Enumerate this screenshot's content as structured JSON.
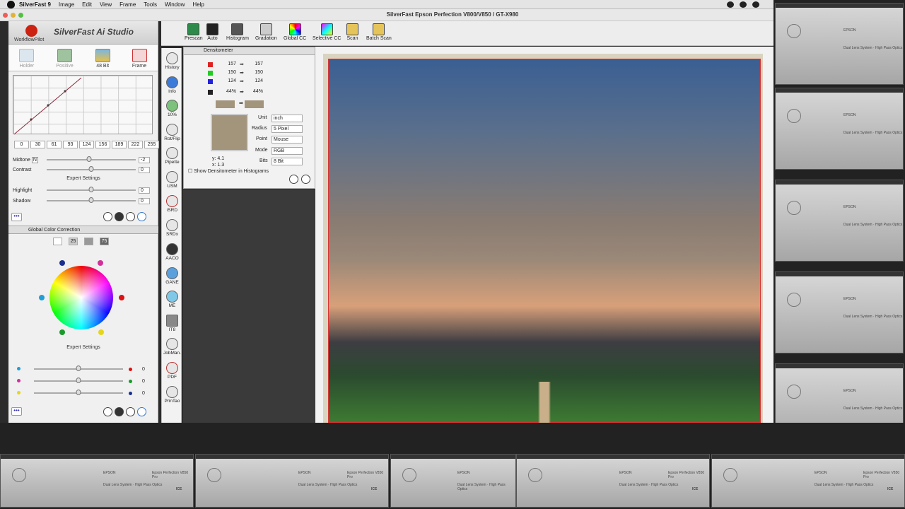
{
  "menubar": {
    "app": "SilverFast 9",
    "items": [
      "Image",
      "Edit",
      "View",
      "Frame",
      "Tools",
      "Window",
      "Help"
    ]
  },
  "window": {
    "title": "SilverFast  Epson Perfection V800/V850 / GT-X980"
  },
  "left_panel": {
    "workflow_pilot": "WorkflowPilot",
    "brand": "SilverFast Ai Studio",
    "modes": [
      "Holder",
      "Positive",
      "48 Bit",
      "Frame"
    ],
    "curve_values": [
      "0",
      "30",
      "61",
      "93",
      "124",
      "156",
      "189",
      "222",
      "255"
    ],
    "midtone": {
      "label": "Midtone",
      "flag": "N",
      "value": "-2",
      "level": 0.48
    },
    "contrast": {
      "label": "Contrast",
      "value": "0",
      "level": 0.5
    },
    "expert_settings": "Expert Settings",
    "highlight": {
      "label": "Highlight",
      "value": "0",
      "level": 0.5
    },
    "shadow": {
      "label": "Shadow",
      "value": "0",
      "level": 0.5
    },
    "more": "•••",
    "gcc": {
      "title": "Global Color Correction",
      "view_buttons": [
        "",
        "25",
        "",
        "75"
      ],
      "expert_settings": "Expert Settings",
      "sliders": [
        {
          "value": "0",
          "left_color": "#1e9fd6",
          "right_color": "#d11",
          "level": 0.5
        },
        {
          "value": "0",
          "left_color": "#d22f9a",
          "right_color": "#1a9a2a",
          "level": 0.5
        },
        {
          "value": "0",
          "left_color": "#e6d61a",
          "right_color": "#1b2f8f",
          "level": 0.5
        }
      ]
    }
  },
  "tool_strip": [
    "History",
    "Info",
    "10%",
    "Rot/Flip",
    "Pipette",
    "USM",
    "iSRD",
    "SRDx",
    "AACO",
    "GANE",
    "ME",
    "IT8",
    "JobMan.",
    "PDF",
    "PrinTao"
  ],
  "top_toolbar": [
    "Prescan",
    "Auto",
    "Histogram",
    "Gradation",
    "Global CC",
    "Selective CC",
    "Scan",
    "Batch Scan"
  ],
  "densitometer": {
    "title": "Densitometer",
    "rows": [
      {
        "ch": "R",
        "before": "157",
        "after": "157",
        "color": "#d22"
      },
      {
        "ch": "G",
        "before": "150",
        "after": "150",
        "color": "#2c2"
      },
      {
        "ch": "B",
        "before": "124",
        "after": "124",
        "color": "#22d"
      },
      {
        "ch": "K",
        "before": "44%",
        "after": "44%",
        "color": "#222"
      }
    ],
    "swatch_color": "#a3957c",
    "unit_label": "Unit",
    "unit": "inch",
    "radius_label": "Radius",
    "radius": "5 Pixel",
    "point_label": "Point",
    "point": "Mouse",
    "mode_label": "Mode",
    "mode": "RGB",
    "bits_label": "Bits",
    "bits": "8 Bit",
    "y": "y: 4.1",
    "x": "x: 1.3",
    "show_label": "Show Densitometer in Histograms"
  },
  "scanner_text": {
    "model": "Epson Perfection V850 Pro",
    "line": "Dual Lens System · High Pass Optics",
    "brand": "EPSON",
    "ice": "ICE"
  }
}
